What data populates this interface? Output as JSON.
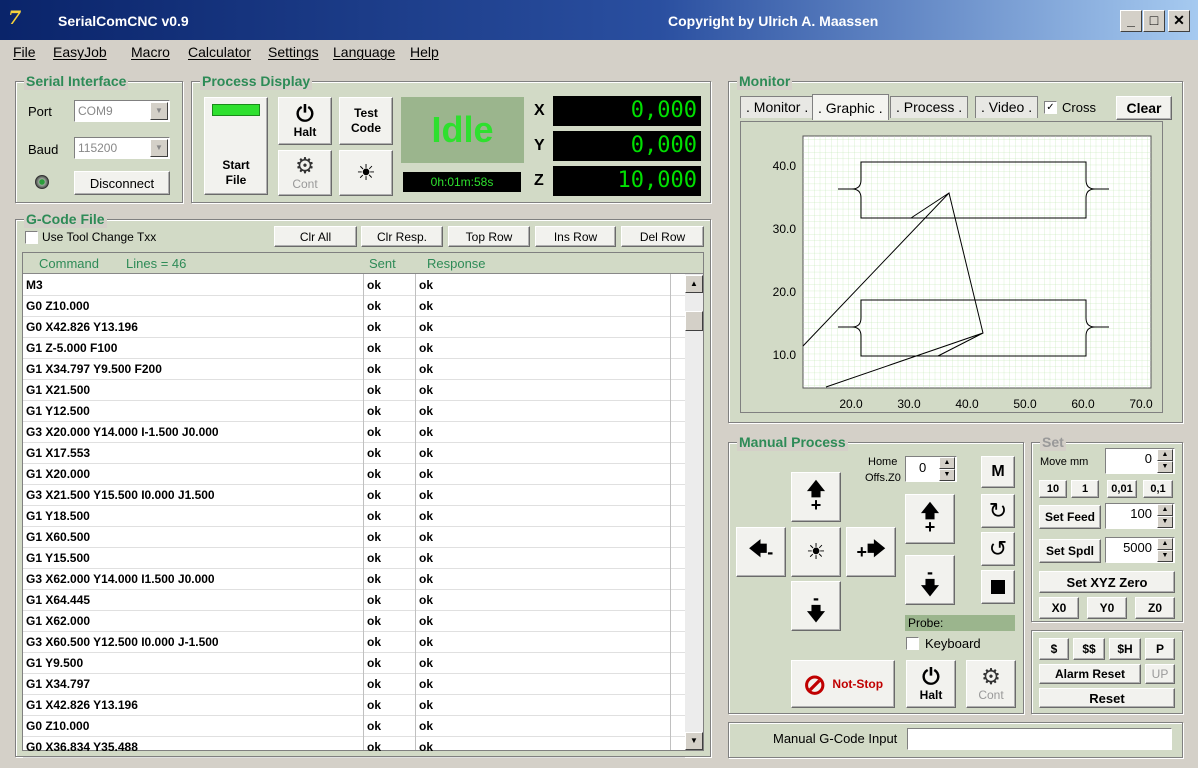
{
  "window": {
    "app_logo": "7",
    "title": "SerialComCNC  v0.9",
    "copyright": "Copyright by Ulrich A. Maassen",
    "minimize": "_",
    "maximize": "□",
    "close": "✕"
  },
  "menu": [
    "File",
    "EasyJob",
    "Macro",
    "Calculator",
    "Settings",
    "Language",
    "Help"
  ],
  "serial": {
    "title": "Serial Interface",
    "port_label": "Port",
    "port_value": "COM9",
    "baud_label": "Baud",
    "baud_value": "115200",
    "disconnect": "Disconnect"
  },
  "process": {
    "title": "Process Display",
    "start_file": "Start File",
    "halt": "Halt",
    "test_code": "Test Code",
    "cont": "Cont",
    "status": "Idle",
    "runtime": "0h:01m:58s",
    "axes": [
      {
        "name": "X",
        "value": "0,000"
      },
      {
        "name": "Y",
        "value": "0,000"
      },
      {
        "name": "Z",
        "value": "10,000"
      }
    ]
  },
  "gcode": {
    "title": "G-Code File",
    "tool_change": "Use Tool Change Txx",
    "buttons": [
      "Clr All",
      "Clr Resp.",
      "Top Row",
      "Ins Row",
      "Del Row"
    ],
    "col_command": "Command",
    "col_lines": "Lines = 46",
    "col_sent": "Sent",
    "col_response": "Response",
    "rows": [
      [
        "M3",
        "ok",
        "ok"
      ],
      [
        "G0 Z10.000",
        "ok",
        "ok"
      ],
      [
        "G0 X42.826 Y13.196",
        "ok",
        "ok"
      ],
      [
        "G1 Z-5.000 F100",
        "ok",
        "ok"
      ],
      [
        "G1 X34.797 Y9.500 F200",
        "ok",
        "ok"
      ],
      [
        "G1 X21.500",
        "ok",
        "ok"
      ],
      [
        "G1 Y12.500",
        "ok",
        "ok"
      ],
      [
        "G3 X20.000 Y14.000 I-1.500 J0.000",
        "ok",
        "ok"
      ],
      [
        "G1 X17.553",
        "ok",
        "ok"
      ],
      [
        "G1 X20.000",
        "ok",
        "ok"
      ],
      [
        "G3 X21.500 Y15.500 I0.000 J1.500",
        "ok",
        "ok"
      ],
      [
        "G1 Y18.500",
        "ok",
        "ok"
      ],
      [
        "G1 X60.500",
        "ok",
        "ok"
      ],
      [
        "G1 Y15.500",
        "ok",
        "ok"
      ],
      [
        "G3 X62.000 Y14.000 I1.500 J0.000",
        "ok",
        "ok"
      ],
      [
        "G1 X64.445",
        "ok",
        "ok"
      ],
      [
        "G1 X62.000",
        "ok",
        "ok"
      ],
      [
        "G3 X60.500 Y12.500 I0.000 J-1.500",
        "ok",
        "ok"
      ],
      [
        "G1 Y9.500",
        "ok",
        "ok"
      ],
      [
        "G1 X34.797",
        "ok",
        "ok"
      ],
      [
        "G1 X42.826 Y13.196",
        "ok",
        "ok"
      ],
      [
        "G0 Z10.000",
        "ok",
        "ok"
      ],
      [
        "G0 X36.834 Y35.488",
        "ok",
        "ok"
      ]
    ]
  },
  "monitor": {
    "title": "Monitor",
    "tabs": [
      ". Monitor .",
      ". Graphic .",
      ". Process .",
      ". Video ."
    ],
    "cross_label": "Cross",
    "clear": "Clear",
    "y_ticks": [
      "40.0",
      "30.0",
      "20.0",
      "10.0"
    ],
    "x_ticks": [
      "20.0",
      "30.0",
      "40.0",
      "50.0",
      "60.0",
      "70.0"
    ]
  },
  "manual": {
    "title": "Manual Process",
    "home_label": "Home",
    "offs_label": "Offs.Z0",
    "offs_value": "0",
    "m_btn": "M",
    "y_plus": "+",
    "y_minus": "-",
    "x_minus": "-",
    "x_plus": "+",
    "z_plus": "+",
    "z_minus": "-",
    "probe_label": "Probe:",
    "keyboard_label": "Keyboard",
    "not_stop": "Not-Stop",
    "halt": "Halt",
    "cont": "Cont"
  },
  "set": {
    "title": "Set",
    "move_label": "Move mm",
    "move_value": "0",
    "steps": [
      "10",
      "1",
      "0,01",
      "0,1"
    ],
    "set_feed": "Set Feed",
    "feed_value": "100",
    "set_spdl": "Set Spdl",
    "spdl_value": "5000",
    "set_xyz_zero": "Set XYZ Zero",
    "zeros": [
      "X0",
      "Y0",
      "Z0"
    ]
  },
  "commands": {
    "dollar": "$",
    "dollar2": "$$",
    "home": "$H",
    "p": "P",
    "alarm_reset": "Alarm Reset",
    "up": "UP",
    "reset": "Reset"
  },
  "manual_input": {
    "label": "Manual G-Code Input",
    "value": ""
  }
}
